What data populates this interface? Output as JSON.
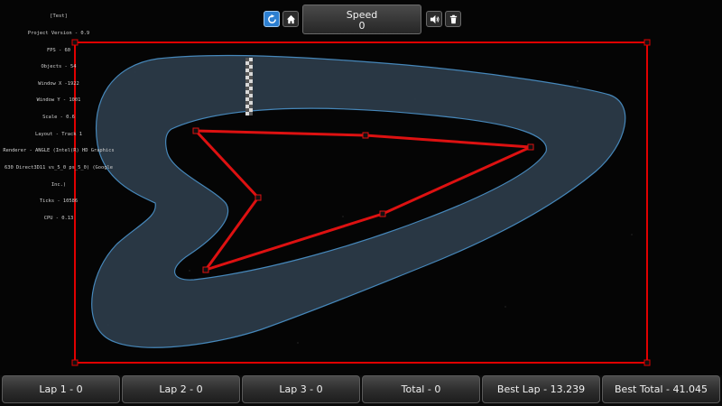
{
  "debug": [
    "[Test]",
    "Project Version - 0.9",
    "FPS - 60",
    "Objects - 54",
    "Window X -1922",
    "Window Y - 1001",
    "Scale - 0.6",
    "Layout - Track 1",
    "Renderer - ANGLE (Intel(R) HD Graphics",
    "630 Direct3D11 vs_5_0 ps_5_0) (Google",
    "Inc.)",
    "Ticks - 10586",
    "CPU - 0.13"
  ],
  "toolbar": {
    "restart_icon": "restart-icon",
    "home_icon": "home-icon",
    "sound_icon": "speaker-icon",
    "trash_icon": "trash-icon"
  },
  "speed": {
    "label": "Speed",
    "value": "0"
  },
  "stats": {
    "lap1": "Lap 1 - 0",
    "lap2": "Lap 2 - 0",
    "lap3": "Lap 3 - 0",
    "total": "Total - 0",
    "best_lap": "Best Lap - 13.239",
    "best_total": "Best Total - 41.045"
  },
  "colors": {
    "background": "#050505",
    "track_fill": "#2b3a48",
    "track_edge": "#4a8fc4",
    "boundary": "#e00000",
    "path": "#dd1111",
    "accent": "#2c7fd1"
  }
}
